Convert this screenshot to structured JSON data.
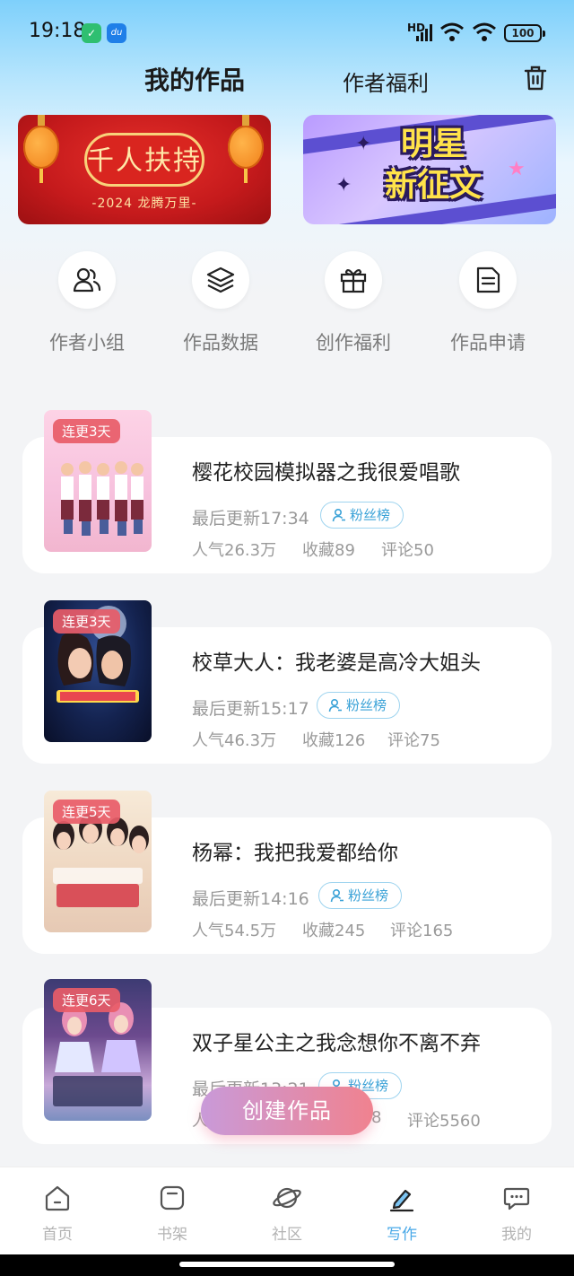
{
  "status_bar": {
    "time": "19:18",
    "signal_label": "HD",
    "battery": "100"
  },
  "header": {
    "tab_active": "我的作品",
    "tab_other": "作者福利"
  },
  "banners": {
    "left": {
      "title": "千人扶持",
      "subtitle": "-2024 龙腾万里-"
    },
    "right": {
      "title_line1": "明星",
      "title_line2": "新征文"
    }
  },
  "quick_actions": [
    {
      "label": "作者小组",
      "icon": "group-icon"
    },
    {
      "label": "作品数据",
      "icon": "layers-icon"
    },
    {
      "label": "创作福利",
      "icon": "gift-icon"
    },
    {
      "label": "作品申请",
      "icon": "document-icon"
    }
  ],
  "works": [
    {
      "badge": "连更3天",
      "title": "樱花校园模拟器之我很爱唱歌",
      "last_update": "最后更新17:34",
      "fans_label": "粉丝榜",
      "popularity": "人气26.3万",
      "favorites": "收藏89",
      "comments": "评论50"
    },
    {
      "badge": "连更3天",
      "title": "校草大人：我老婆是高冷大姐头",
      "last_update": "最后更新15:17",
      "fans_label": "粉丝榜",
      "popularity": "人气46.3万",
      "favorites": "收藏126",
      "comments": "评论75"
    },
    {
      "badge": "连更5天",
      "title": "杨幂：我把我爱都给你",
      "last_update": "最后更新14:16",
      "fans_label": "粉丝榜",
      "popularity": "人气54.5万",
      "favorites": "收藏245",
      "comments": "评论165"
    },
    {
      "badge": "连更6天",
      "title": "双子星公主之我念想你不离不弃",
      "last_update": "最后更新13:21",
      "fans_label": "粉丝榜",
      "popularity": "人",
      "favorites": "8",
      "comments": "评论5560"
    }
  ],
  "create_button": "创建作品",
  "bottom_nav": [
    {
      "label": "首页",
      "icon": "home-icon"
    },
    {
      "label": "书架",
      "icon": "bookshelf-icon"
    },
    {
      "label": "社区",
      "icon": "planet-icon"
    },
    {
      "label": "写作",
      "icon": "pen-icon",
      "active": true
    },
    {
      "label": "我的",
      "icon": "chat-icon"
    }
  ],
  "colors": {
    "accent": "#4aa9e8",
    "badge": "#e85c68",
    "fans": "#3aa2d7"
  }
}
